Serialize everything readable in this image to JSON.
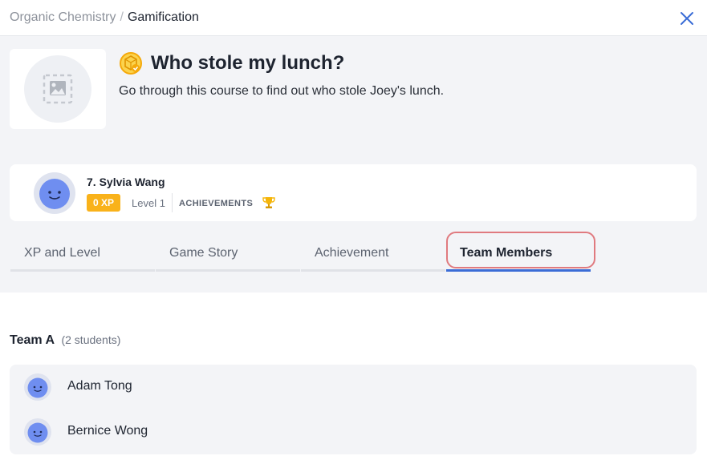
{
  "breadcrumb": {
    "parent": "Organic Chemistry",
    "separator": "/",
    "current": "Gamification"
  },
  "course": {
    "title": "Who stole my lunch?",
    "description": "Go through this course to find out who stole Joey's lunch."
  },
  "profile": {
    "name": "7. Sylvia Wang",
    "xp": "0 XP",
    "level": "Level 1",
    "achievements_label": "ACHIEVEMENTS"
  },
  "tabs": [
    {
      "label": "XP and Level"
    },
    {
      "label": "Game Story"
    },
    {
      "label": "Achievement"
    },
    {
      "label": "Team Members"
    }
  ],
  "active_tab": "Team Members",
  "team": {
    "name": "Team A",
    "count": "(2 students)",
    "members": [
      {
        "name": "Adam Tong"
      },
      {
        "name": "Bernice Wong"
      }
    ]
  },
  "colors": {
    "accent": "#3a6cd6",
    "xp_badge": "#f9b21a",
    "highlight": "#e07a7f"
  }
}
